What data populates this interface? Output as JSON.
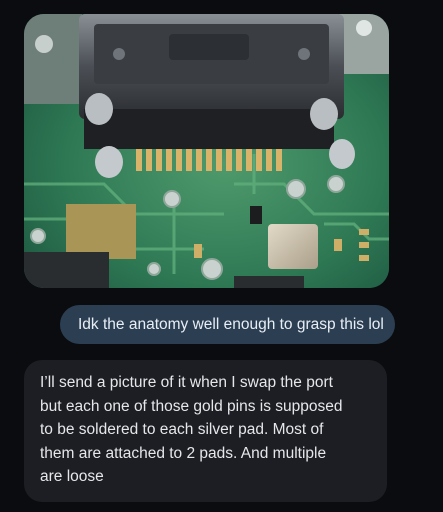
{
  "colors": {
    "background": "#0b0c10",
    "outgoing_bubble": "#2c3f52",
    "incoming_bubble": "#1d1e23",
    "text": "#e8eef5"
  },
  "messages": {
    "photo": {
      "description_icon": "circuit-board-photo"
    },
    "outgoing": {
      "text": "Idk the anatomy well enough to grasp this lol"
    },
    "incoming": {
      "lines": [
        "I’ll send a picture of it when I swap the port",
        "but each one of those gold pins is supposed",
        "to be soldered to each silver pad. Most of",
        "them are attached to 2 pads. And multiple",
        "are loose"
      ]
    }
  }
}
